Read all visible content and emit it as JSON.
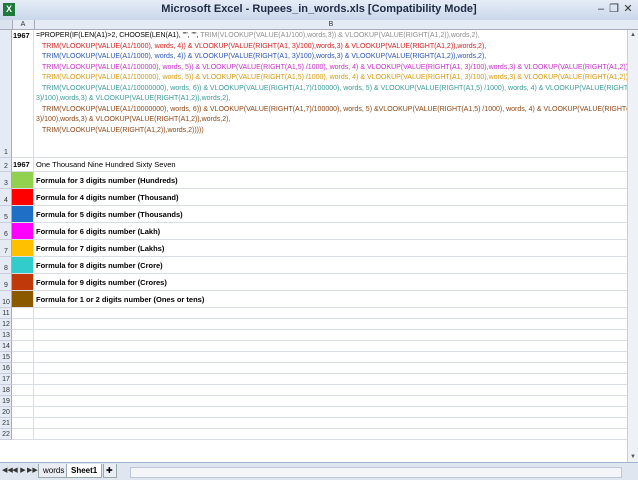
{
  "window": {
    "title": "Microsoft Excel - Rupees_in_words.xls  [Compatibility Mode]",
    "app_icon": "excel-icon",
    "controls": [
      "minimize",
      "restore",
      "close"
    ]
  },
  "columns": [
    "A",
    "B"
  ],
  "formula_row": {
    "row_number": "1",
    "a_value": "1967",
    "lines": [
      [
        {
          "c": "black",
          "t": "=PROPER(IF(LEN(A1)>2, CHOOSE(LEN(A1), \"\", \"\", "
        },
        {
          "c": "grey",
          "t": "TRIM(VLOOKUP(VALUE(A1/100),words,3)) & VLOOKUP(VALUE(RIGHT(A1,2)),words,2),"
        }
      ],
      [
        {
          "c": "red",
          "t": "TRIM(VLOOKUP(VALUE(A1/1000), words, 4)) & VLOOKUP(VALUE(RIGHT(A1, 3)/100),words,3) & VLOOKUP(VALUE(RIGHT(A1,2)),words,2),"
        }
      ],
      [
        {
          "c": "blue",
          "t": "TRIM(VLOOKUP(VALUE(A1/1000), words, 4)) & VLOOKUP(VALUE(RIGHT(A1, 3)/100),words,3) & VLOOKUP(VALUE(RIGHT(A1,2)),words,2),"
        }
      ],
      [
        {
          "c": "mag",
          "t": "TRIM(VLOOKUP(VALUE(A1/100000), words, 5)) & VLOOKUP(VALUE(RIGHT(A1,5) /1000), words, 4) & VLOOKUP(VALUE(RIGHT(A1, 3)/100),words,3) & VLOOKUP(VALUE(RIGHT(A1,2)),words,2),"
        }
      ],
      [
        {
          "c": "orange",
          "t": "TRIM(VLOOKUP(VALUE(A1/100000), words, 5)) & VLOOKUP(VALUE(RIGHT(A1,5) /1000), words, 4) & VLOOKUP(VALUE(RIGHT(A1, 3)/100),words,3) & VLOOKUP(VALUE(RIGHT(A1,2)),words,2),"
        }
      ],
      [
        {
          "c": "teal",
          "t": "TRIM(VLOOKUP(VALUE(A1/10000000), words, 6)) & VLOOKUP(VALUE(RIGHT(A1,7)/100000), words, 5) & VLOOKUP(VALUE(RIGHT(A1,5) /1000), words, 4) & VLOOKUP(VALUE(RIGHT(A1,"
        }
      ],
      [
        {
          "c": "teal",
          "t": "3)/100),words,3) & VLOOKUP(VALUE(RIGHT(A1,2)),words,2),"
        }
      ],
      [
        {
          "c": "brown",
          "t": "TRIM(VLOOKUP(VALUE(A1/10000000), words, 6)) & VLOOKUP(VALUE(RIGHT(A1,7)/100000), words, 5) &VLOOKUP(VALUE(RIGHT(A1,5) /1000), words, 4) & VLOOKUP(VALUE(RIGHT(A1,"
        }
      ],
      [
        {
          "c": "brown",
          "t": "3)/100),words,3) & VLOOKUP(VALUE(RIGHT(A1,2)),words,2),"
        }
      ],
      [
        {
          "c": "brown",
          "t": "TRIM(VLOOKUP(VALUE(RIGHT(A1,2)),words,2)))))"
        }
      ]
    ]
  },
  "rows": [
    {
      "num": "2",
      "a": "1967",
      "b": "One Thousand Nine Hundred Sixty Seven",
      "swatch": ""
    },
    {
      "num": "3",
      "a": "",
      "b": "Formula for 3 digits number (Hundreds)",
      "swatch": "#92d050"
    },
    {
      "num": "4",
      "a": "",
      "b": "Formula for 4 digits number (Thousand)",
      "swatch": "#ff0000"
    },
    {
      "num": "5",
      "a": "",
      "b": "Formula for 5 digits number (Thousands)",
      "swatch": "#1f6fc6"
    },
    {
      "num": "6",
      "a": "",
      "b": "Formula for 6 digits number (Lakh)",
      "swatch": "#ff00ff"
    },
    {
      "num": "7",
      "a": "",
      "b": "Formula for 7 digits number (Lakhs)",
      "swatch": "#ffc000"
    },
    {
      "num": "8",
      "a": "",
      "b": "Formula for 8 digits number (Crore)",
      "swatch": "#33cccc"
    },
    {
      "num": "9",
      "a": "",
      "b": "Formula for 9 digits number (Crores)",
      "swatch": "#c0390b"
    },
    {
      "num": "10",
      "a": "",
      "b": "Formula for 1 or 2 digits number (Ones or tens)",
      "swatch": "#8b5a00"
    },
    {
      "num": "11",
      "a": "",
      "b": "",
      "swatch": ""
    },
    {
      "num": "12",
      "a": "",
      "b": "",
      "swatch": ""
    },
    {
      "num": "13",
      "a": "",
      "b": "",
      "swatch": ""
    },
    {
      "num": "14",
      "a": "",
      "b": "",
      "swatch": ""
    },
    {
      "num": "15",
      "a": "",
      "b": "",
      "swatch": ""
    },
    {
      "num": "16",
      "a": "",
      "b": "",
      "swatch": ""
    },
    {
      "num": "17",
      "a": "",
      "b": "",
      "swatch": ""
    },
    {
      "num": "18",
      "a": "",
      "b": "",
      "swatch": ""
    },
    {
      "num": "19",
      "a": "",
      "b": "",
      "swatch": ""
    },
    {
      "num": "20",
      "a": "",
      "b": "",
      "swatch": ""
    },
    {
      "num": "21",
      "a": "",
      "b": "",
      "swatch": ""
    },
    {
      "num": "22",
      "a": "",
      "b": "",
      "swatch": ""
    }
  ],
  "sheet_tabs": {
    "nav": [
      "◀◀",
      "◀",
      "▶",
      "▶▶"
    ],
    "tabs": [
      "words",
      "Sheet1"
    ],
    "active": "Sheet1"
  }
}
